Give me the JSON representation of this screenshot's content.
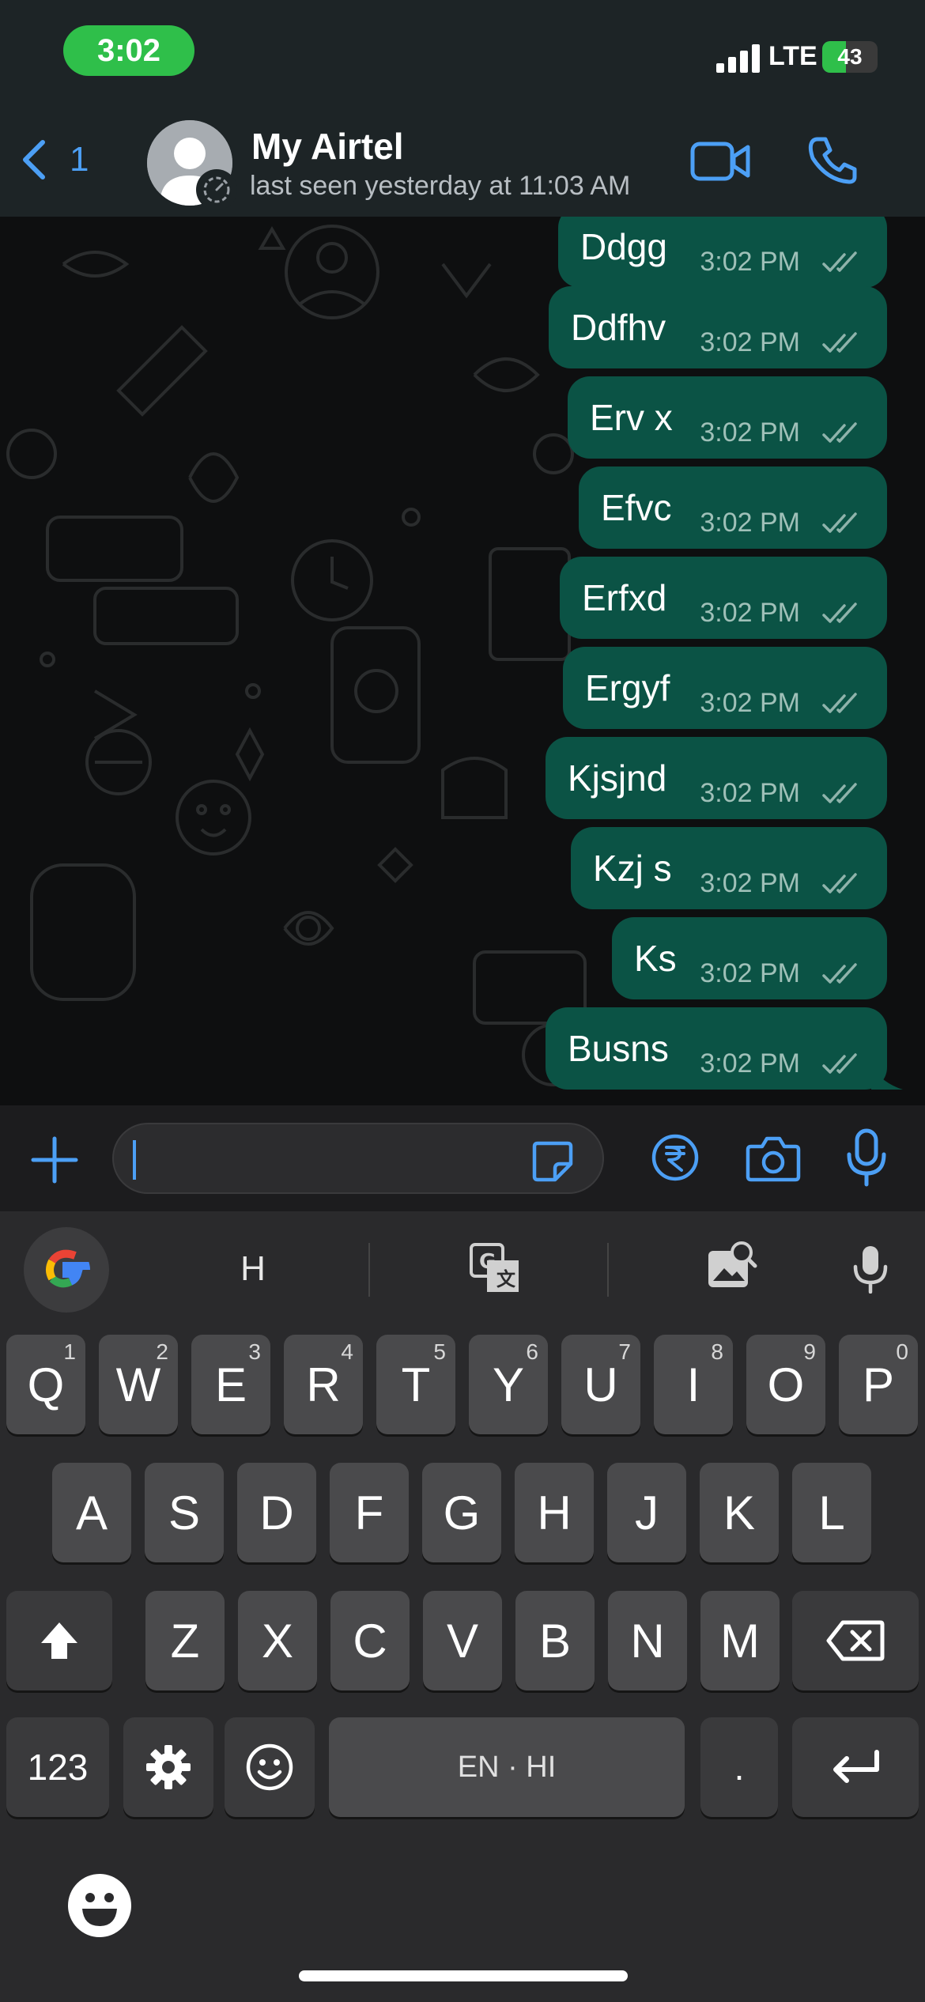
{
  "status_bar": {
    "time": "3:02",
    "network": "LTE",
    "battery": "43",
    "battery_level_percent": 43
  },
  "header": {
    "back_count": "1",
    "contact_name": "My Airtel",
    "contact_status": "last seen yesterday at 11:03 AM",
    "icons": [
      "chevron-left-icon",
      "video-call-icon",
      "phone-icon"
    ]
  },
  "messages": [
    {
      "text": "Ddgg",
      "time": "3:02 PM",
      "status": "read"
    },
    {
      "text": "Ddfhv",
      "time": "3:02 PM",
      "status": "read"
    },
    {
      "text": "Erv x",
      "time": "3:02 PM",
      "status": "read"
    },
    {
      "text": "Efvc",
      "time": "3:02 PM",
      "status": "read"
    },
    {
      "text": "Erfxd",
      "time": "3:02 PM",
      "status": "read"
    },
    {
      "text": "Ergyf",
      "time": "3:02 PM",
      "status": "read"
    },
    {
      "text": "Kjsjnd",
      "time": "3:02 PM",
      "status": "read"
    },
    {
      "text": "Kzj s",
      "time": "3:02 PM",
      "status": "read"
    },
    {
      "text": "Ks",
      "time": "3:02 PM",
      "status": "read"
    },
    {
      "text": "Busns",
      "time": "3:02 PM",
      "status": "read"
    }
  ],
  "input_bar": {
    "placeholder": "",
    "value": "",
    "icons": [
      "plus-icon",
      "sticker-icon",
      "rupee-payment-icon",
      "camera-icon",
      "microphone-icon"
    ]
  },
  "keyboard": {
    "suggestions": [
      "H"
    ],
    "suggestion_icons": [
      "google-icon",
      "translate-icon",
      "lens-search-icon",
      "voice-input-icon"
    ],
    "row1": [
      {
        "label": "Q",
        "num": "1"
      },
      {
        "label": "W",
        "num": "2"
      },
      {
        "label": "E",
        "num": "3"
      },
      {
        "label": "R",
        "num": "4"
      },
      {
        "label": "T",
        "num": "5"
      },
      {
        "label": "Y",
        "num": "6"
      },
      {
        "label": "U",
        "num": "7"
      },
      {
        "label": "I",
        "num": "8"
      },
      {
        "label": "O",
        "num": "9"
      },
      {
        "label": "P",
        "num": "0"
      }
    ],
    "row2": [
      "A",
      "S",
      "D",
      "F",
      "G",
      "H",
      "J",
      "K",
      "L"
    ],
    "row3": [
      "Z",
      "X",
      "C",
      "V",
      "B",
      "N",
      "M"
    ],
    "numbers_key": "123",
    "space_label": "EN · HI",
    "period_key": "."
  },
  "colors": {
    "accent": "#4c9ff5",
    "bubble_outgoing": "#0b5345",
    "status_time_pill": "#2fbf4a",
    "header_bg": "#1d2426",
    "keyboard_bg": "#2a2a2c",
    "key_bg": "#4a4a4c"
  }
}
